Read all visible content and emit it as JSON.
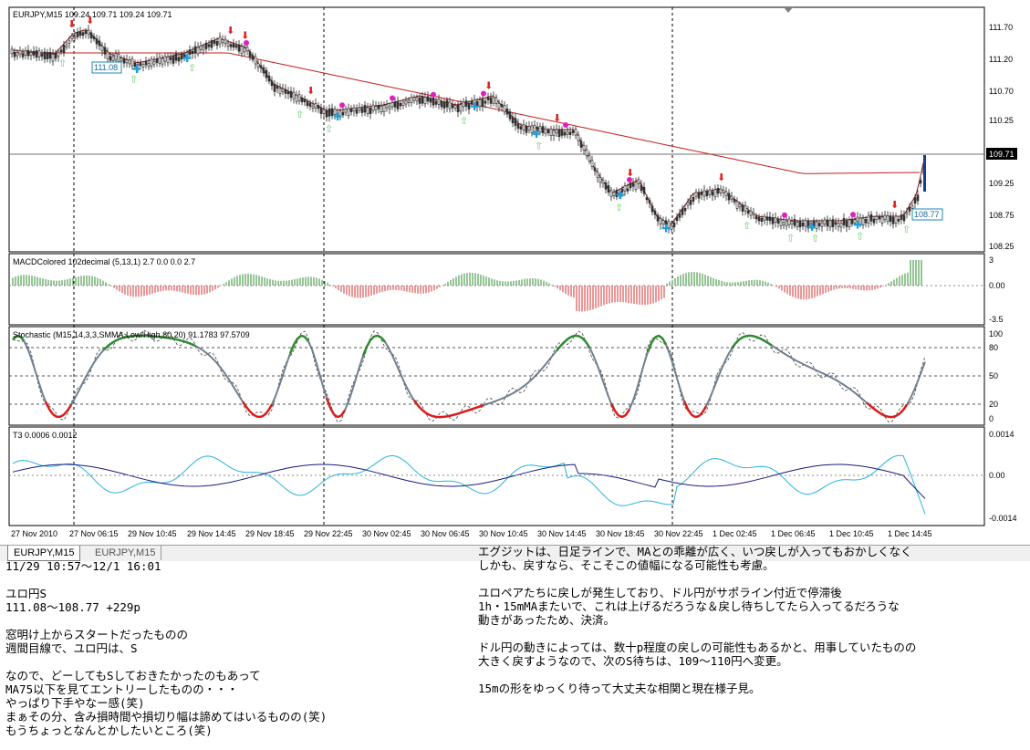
{
  "chart": {
    "main_title": "EURJPY,M15  109.24 109.71 109.24 109.71",
    "price_labels": [
      "111.70",
      "111.20",
      "110.70",
      "110.25",
      "109.25",
      "108.75",
      "108.25"
    ],
    "current_price": "109.71",
    "label_start_price": "111.08",
    "label_end_price": "108.77",
    "macd_title": "MACDColored 102decimal (5,13,1) 2.7 0.0 0.0 2.7",
    "macd_labels": [
      "3",
      "0.00",
      "-3.5"
    ],
    "stoch_title": "Stochastic (M15,14,3,3,SMMA,Low/High,80,20) 91.1783 97.5709",
    "stoch_labels": [
      "100",
      "80",
      "50",
      "20",
      "0"
    ],
    "t3_title": "T3 0.0006 0.0012",
    "t3_labels": [
      "0.0014",
      "0.00",
      "-0.0014"
    ],
    "time_labels": [
      "27 Nov 2010",
      "27 Nov 06:15",
      "29 Nov 10:45",
      "29 Nov 14:45",
      "29 Nov 18:45",
      "29 Nov 22:45",
      "30 Nov 02:45",
      "30 Nov 06:45",
      "30 Nov 10:45",
      "30 Nov 14:45",
      "30 Nov 18:45",
      "30 Nov 22:45",
      "1 Dec 02:45",
      "1 Dec 06:45",
      "1 Dec 10:45",
      "1 Dec 14:45"
    ],
    "colors": {
      "ma_slow": "#c81e1e",
      "bull_candle": "#3a3a3a",
      "up_arrow": "#66cc66",
      "down_arrow": "#e02020",
      "stoch_line": "#708090",
      "stoch_overbought": "#2e8b2e",
      "stoch_oversold": "#dd1a1a",
      "t3_fast": "#28b4dc",
      "t3_slow": "#1a1a80"
    }
  },
  "tabs": {
    "active": "EURJPY,M15",
    "inactive": "EURJPY,M15"
  },
  "notes_left": [
    "11/29 10:57～12/1 16:01",
    "",
    "ユロ円S",
    "111.08～108.77 +229p",
    "",
    "窓明け上からスタートだったものの",
    "週間目線で、ユロ円は、S",
    "",
    "なので、どーしてもSしておきたかったのもあって",
    "MA75以下を見てエントリーしたものの・・・",
    "やっぱり下手やなー感(笑)",
    "まぁその分、含み損時間や損切り幅は諦めてはいるものの(笑)",
    "もうちょっとなんとかしたいところ(笑)"
  ],
  "notes_right": [
    "エグジットは、日足ラインで、MAとの乖離が広く、いつ戻しが入ってもおかしくなく",
    "しかも、戻すなら、そこそこの値幅になる可能性も考慮。",
    "",
    "ユロペアたちに戻しが発生しており、ドル円がサポライン付近で停滞後",
    "1h・15mMAまたいで、これは上げるだろうな＆戻し待ちしてたら入ってるだろうな",
    "動きがあったため、決済。",
    "",
    "ドル円の動きによっては、数十p程度の戻しの可能性もあるかと、用事していたものの",
    "大きく戻すようなので、次のS待ちは、109～110円へ変更。",
    "",
    "15mの形をゆっくり待って大丈夫な相関と現在様子見。"
  ]
}
